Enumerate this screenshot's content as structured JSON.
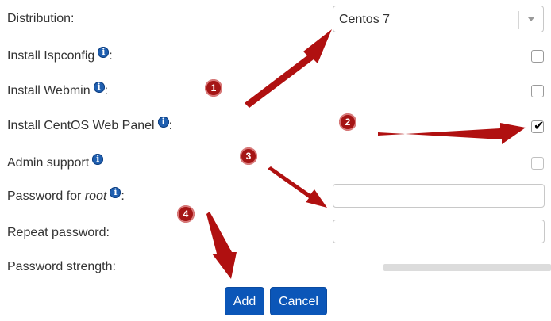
{
  "form": {
    "distribution": {
      "label": "Distribution:",
      "value": "Centos 7"
    },
    "ispconfig": {
      "label": "Install Ispconfig",
      "suffix": ":",
      "checked": false
    },
    "webmin": {
      "label": "Install Webmin",
      "suffix": ":",
      "checked": false
    },
    "cwp": {
      "label": "Install CentOS Web Panel",
      "suffix": ":",
      "checked": true
    },
    "admin_support": {
      "label": "Admin support",
      "checked": false
    },
    "password": {
      "label_prefix": "Password for ",
      "label_em": "root",
      "suffix": ":",
      "value": ""
    },
    "repeat_password": {
      "label": "Repeat password:",
      "value": ""
    },
    "strength": {
      "label": "Password strength:",
      "level": 0
    }
  },
  "buttons": {
    "add": "Add",
    "cancel": "Cancel"
  },
  "info_icon_glyph": "i",
  "checkmark_glyph": "✔",
  "annotations": [
    "1",
    "2",
    "3",
    "4"
  ],
  "colors": {
    "accent": "#0b56b8",
    "annotation": "#a51515",
    "info": "#1f5fb0"
  }
}
